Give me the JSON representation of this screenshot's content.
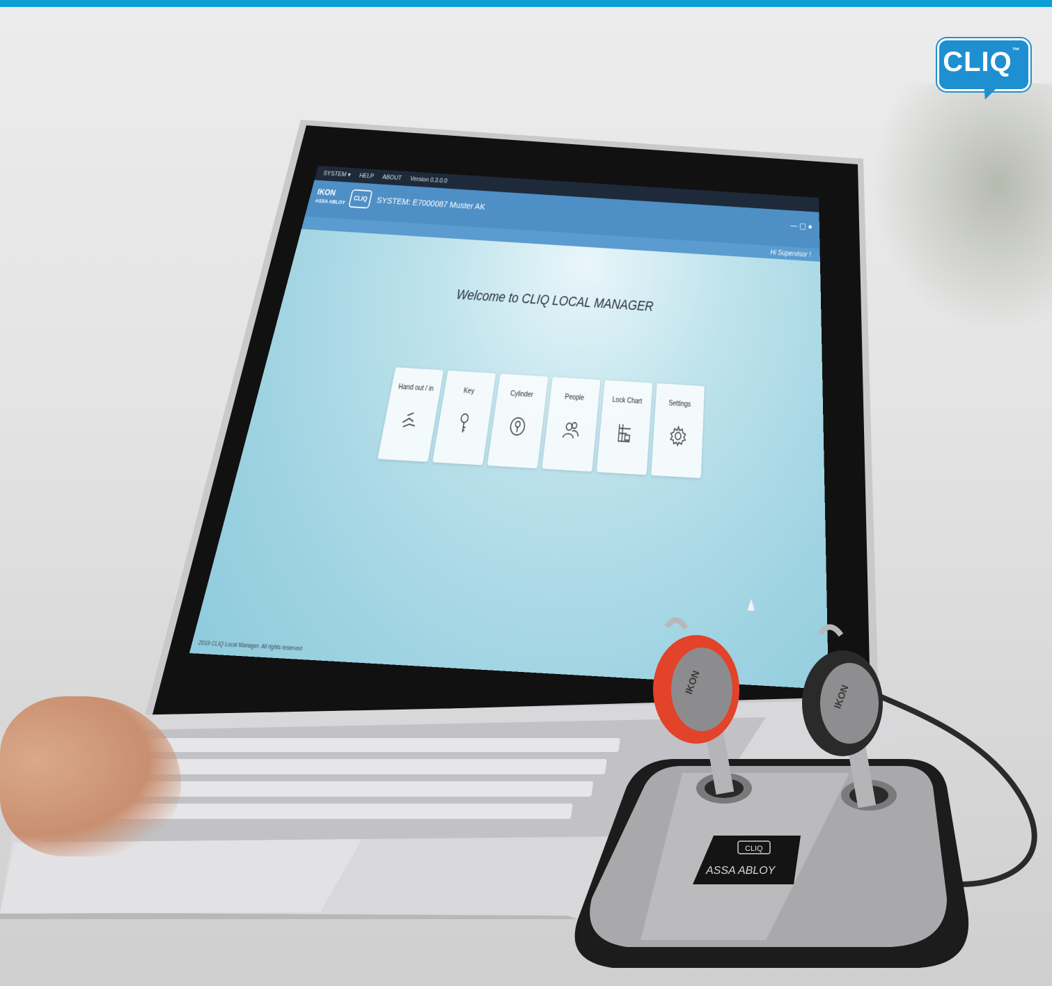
{
  "photo_logo": {
    "brand": "CLIQ",
    "trademark": "™",
    "color": "#1e8fd0"
  },
  "top_bar_color": "#0aa0d6",
  "app": {
    "menu": [
      "SYSTEM ▾",
      "HELP",
      "ABOUT",
      "Version 0.3.0.0"
    ],
    "brand_logo": {
      "line1": "IKON",
      "line2": "ASSA ABLOY"
    },
    "brand_cliq": "CLIQ",
    "system_label": "SYSTEM: E7000087 Muster AK",
    "window_controls": "— ▢ ●",
    "greeting": "Hi Supervisor !",
    "welcome": "Welcome to  CLIQ LOCAL MANAGER",
    "tiles": [
      {
        "label": "Hand out / in",
        "icon": "hand-out-icon"
      },
      {
        "label": "Key",
        "icon": "key-icon"
      },
      {
        "label": "Cylinder",
        "icon": "cylinder-icon"
      },
      {
        "label": "People",
        "icon": "people-icon"
      },
      {
        "label": "Lock Chart",
        "icon": "lock-chart-icon"
      },
      {
        "label": "Settings",
        "icon": "gear-icon"
      }
    ],
    "footer": "2019 CLIQ Local Manager. All rights reserved",
    "accent_color": "#4e8fc6"
  },
  "device": {
    "station_label": "ASSA ABLOY",
    "station_logo": "CLIQ",
    "key_brand": "IKON",
    "key_subbrand": "ASSA ABLOY",
    "key_colors": [
      "#e2432a",
      "#2a2a2a"
    ]
  }
}
